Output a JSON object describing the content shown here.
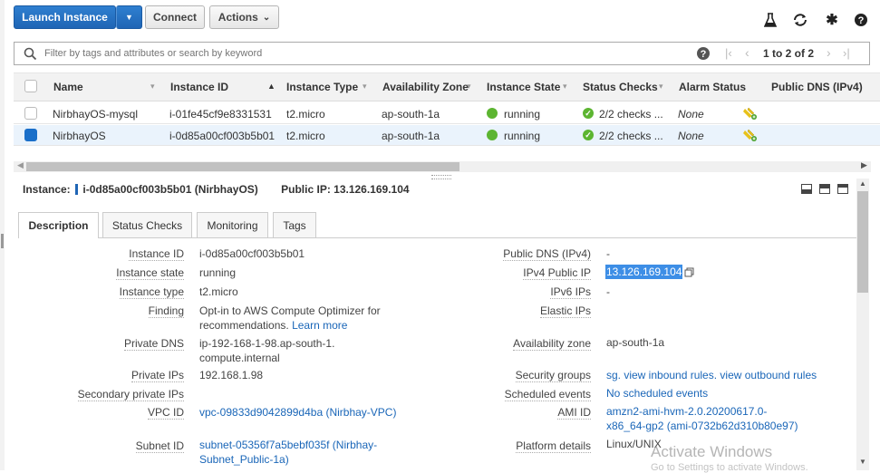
{
  "toolbar": {
    "launch_label": "Launch Instance",
    "connect_label": "Connect",
    "actions_label": "Actions",
    "icons": [
      "flask-icon",
      "refresh-icon",
      "gear-icon",
      "help-icon"
    ]
  },
  "search": {
    "placeholder": "Filter by tags and attributes or search by keyword",
    "pagination": "1 to 2 of 2"
  },
  "table": {
    "columns": [
      "Name",
      "Instance ID",
      "Instance Type",
      "Availability Zone",
      "Instance State",
      "Status Checks",
      "Alarm Status",
      "Public DNS (IPv4)"
    ],
    "rows": [
      {
        "name": "NirbhayOS-mysql",
        "id": "i-01fe45cf9e8331531",
        "type": "t2.micro",
        "az": "ap-south-1a",
        "state": "running",
        "checks": "2/2 checks ...",
        "alarm": "None",
        "selected": false
      },
      {
        "name": "NirbhayOS",
        "id": "i-0d85a00cf003b5b01",
        "type": "t2.micro",
        "az": "ap-south-1a",
        "state": "running",
        "checks": "2/2 checks ...",
        "alarm": "None",
        "selected": true
      }
    ]
  },
  "details": {
    "instance_prefix": "Instance:",
    "instance_id": "i-0d85a00cf003b5b01 (NirbhayOS)",
    "public_ip_label": "Public IP: 13.126.169.104",
    "tabs": [
      "Description",
      "Status Checks",
      "Monitoring",
      "Tags"
    ],
    "left": [
      {
        "label": "Instance ID",
        "value": "i-0d85a00cf003b5b01"
      },
      {
        "label": "Instance state",
        "value": "running"
      },
      {
        "label": "Instance type",
        "value": "t2.micro"
      },
      {
        "label": "Finding",
        "value": "Opt-in to AWS Compute Optimizer for recommendations.",
        "link": "Learn more"
      },
      {
        "label": "Private DNS",
        "value": "ip-192-168-1-98.ap-south-1.compute.internal"
      },
      {
        "label": "Private IPs",
        "value": "192.168.1.98"
      },
      {
        "label": "Secondary private IPs",
        "value": ""
      },
      {
        "label": "VPC ID",
        "link": "vpc-09833d9042899d4ba (Nirbhay-VPC)"
      },
      {
        "label": "Subnet ID",
        "link": "subnet-05356f7a5bebf035f (Nirbhay-Subnet_Public-1a)"
      }
    ],
    "right": [
      {
        "label": "Public DNS (IPv4)",
        "value": "-"
      },
      {
        "label": "IPv4 Public IP",
        "value": "13.126.169.104"
      },
      {
        "label": "IPv6 IPs",
        "value": "-"
      },
      {
        "label": "Elastic IPs",
        "value": ""
      },
      {
        "label": "Availability zone",
        "value": "ap-south-1a"
      },
      {
        "label": "Security groups",
        "link": "sg. view inbound rules. view outbound rules"
      },
      {
        "label": "Scheduled events",
        "link": "No scheduled events"
      },
      {
        "label": "AMI ID",
        "link": "amzn2-ami-hvm-2.0.20200617.0-x86_64-gp2 (ami-0732b62d310b80e97)"
      },
      {
        "label": "Platform details",
        "value": "Linux/UNIX"
      }
    ]
  },
  "watermark": {
    "title": "Activate Windows",
    "subtitle": "Go to Settings to activate Windows."
  },
  "colors": {
    "primary": "#1f65b5",
    "running": "#5cb531",
    "link": "#1a66b8",
    "selected_row": "#eaf3fc"
  }
}
